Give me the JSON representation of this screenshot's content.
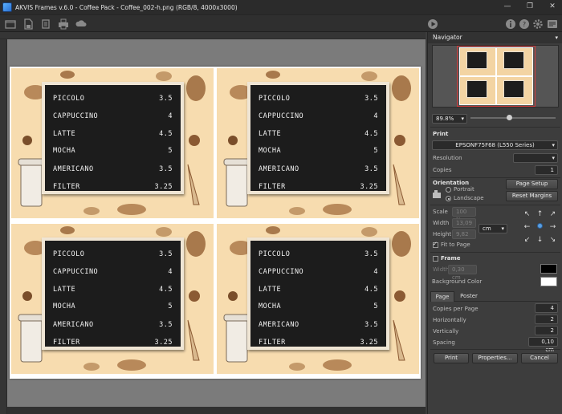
{
  "window": {
    "title": "AKVIS Frames v.6.0 - Coffee Pack - Coffee_002-h.png (RGB/8, 4000x3000)",
    "buttons": [
      "—",
      "❐",
      "✕"
    ]
  },
  "toolbar": {
    "icons": [
      "open-icon",
      "save-icon",
      "batch-icon",
      "print-icon",
      "share-icon",
      "run-icon",
      "info-icon",
      "help-icon",
      "preferences-icon",
      "news-icon"
    ]
  },
  "menu": {
    "items": [
      {
        "name": "PICCOLO",
        "price": "3.5"
      },
      {
        "name": "CAPPUCCINO",
        "price": "4"
      },
      {
        "name": "LATTE",
        "price": "4.5"
      },
      {
        "name": "MOCHA",
        "price": "5"
      },
      {
        "name": "AMERICANO",
        "price": "3.5"
      },
      {
        "name": "FILTER",
        "price": "3.25"
      }
    ]
  },
  "navigator": {
    "title": "Navigator",
    "zoom": "89.8%",
    "zoom_level": 0.45
  },
  "print": {
    "section": "Print",
    "printer": "EPSONF75F68 (L550 Series)",
    "resolution_label": "Resolution",
    "resolution_value": "",
    "copies_label": "Copies",
    "copies_value": "1"
  },
  "orientation": {
    "label": "Orientation",
    "portrait": "Portrait",
    "landscape": "Landscape",
    "page_setup": "Page Setup",
    "reset_margins": "Reset Margins"
  },
  "scale": {
    "scale_label": "Scale",
    "width_label": "Width",
    "height_label": "Height",
    "scale_value": "100 %",
    "width_value": "13,09",
    "height_value": "9,82",
    "unit": "cm",
    "fit_label": "Fit to Page"
  },
  "frame": {
    "label": "Frame",
    "width_label": "Width",
    "width_value": "0,30 cm"
  },
  "background": {
    "label": "Background Color",
    "frame_color": "#000000",
    "bg_color": "#ffffff"
  },
  "tabs": {
    "page": "Page",
    "poster": "Poster"
  },
  "page_settings": {
    "copies_per_page_label": "Copies per Page",
    "copies_per_page": "4",
    "horizontally_label": "Horizontally",
    "horizontally": "2",
    "vertically_label": "Vertically",
    "vertically": "2",
    "spacing_label": "Spacing",
    "spacing": "0,10 cm"
  },
  "actions": {
    "print": "Print",
    "properties": "Properties...",
    "cancel": "Cancel"
  }
}
